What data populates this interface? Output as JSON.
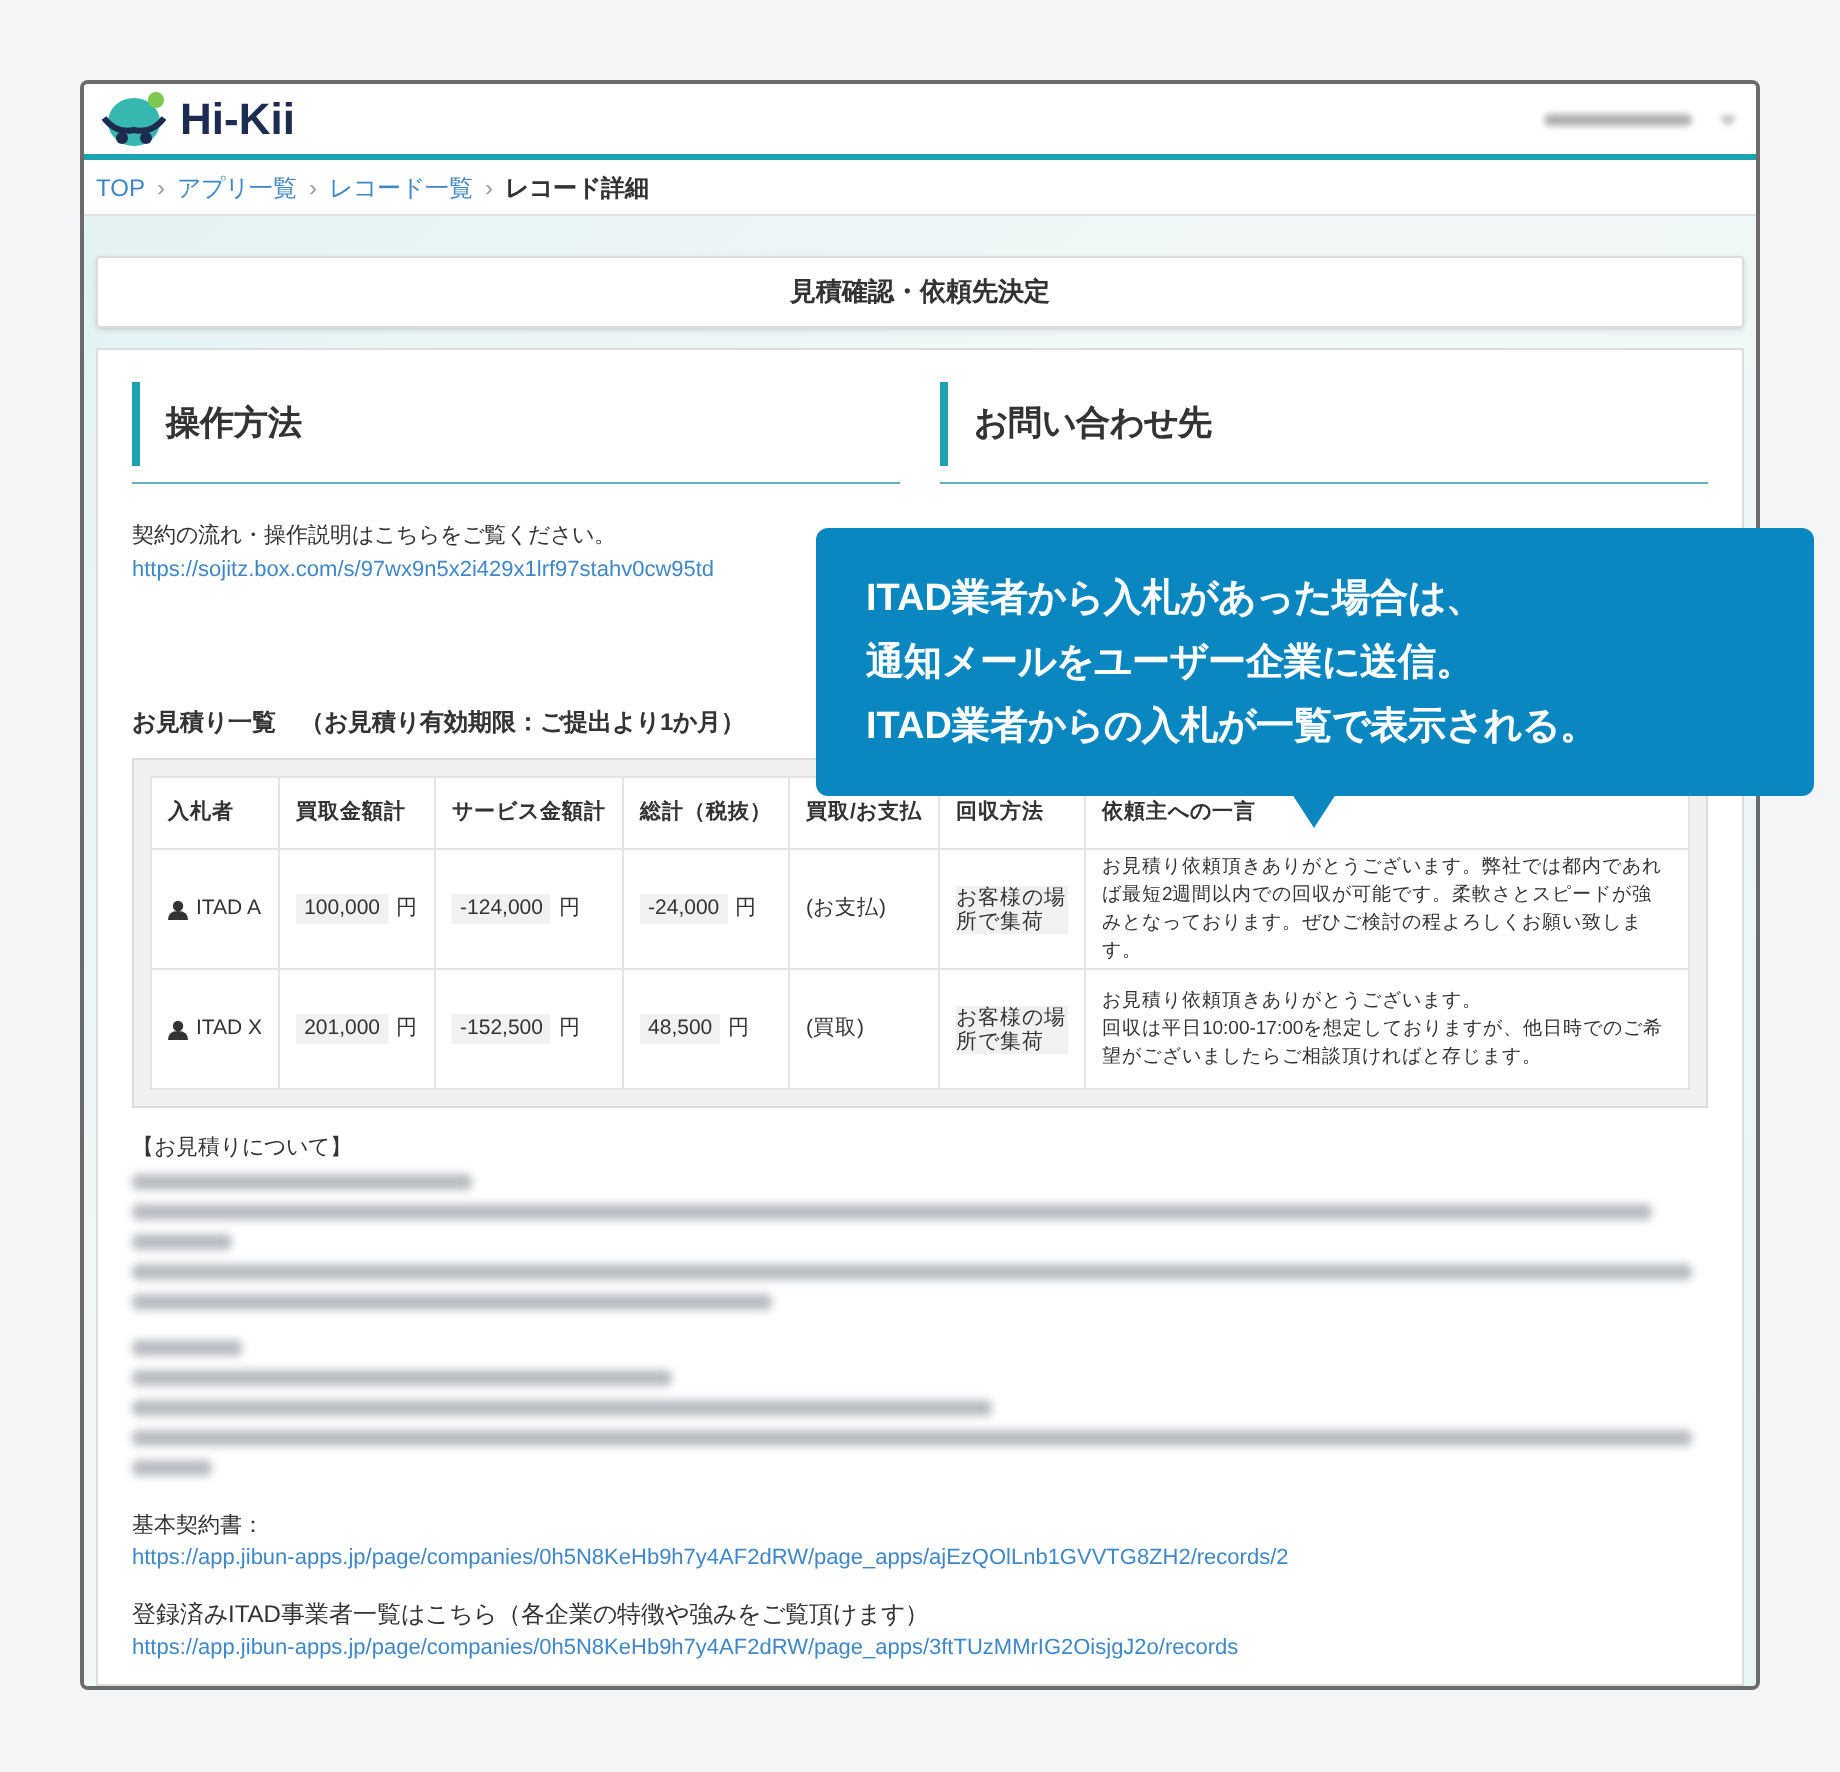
{
  "header": {
    "logo_text": "Hi-Kii"
  },
  "breadcrumb_separator": "›",
  "breadcrumb": [
    {
      "label": "TOP",
      "link": true
    },
    {
      "label": "アプリ一覧",
      "link": true
    },
    {
      "label": "レコード一覧",
      "link": true
    },
    {
      "label": "レコード詳細",
      "link": false
    }
  ],
  "page_title": "見積確認・依頼先決定",
  "sections": [
    {
      "title": "操作方法",
      "text": "契約の流れ・操作説明はこちらをご覧ください。",
      "link": "https://sojitz.box.com/s/97wx9n5x2i429x1lrf97stahv0cw95td"
    },
    {
      "title": "お問い合わせ先"
    }
  ],
  "quotes": {
    "title": "お見積り一覧　（お見積り有効期限：ご提出より1か月）",
    "columns": [
      "入札者",
      "買取金額計",
      "サービス金額計",
      "総計（税抜）",
      "買取/お支払",
      "回収方法",
      "依頼主への一言"
    ],
    "rows": [
      {
        "bidder": "ITAD A",
        "buy": {
          "value": "100,000",
          "unit": "円"
        },
        "service": {
          "value": "-124,000",
          "unit": "円"
        },
        "total": {
          "value": "-24,000",
          "unit": "円"
        },
        "payment": "(お支払)",
        "collection": "お客様の場所で集荷",
        "message": [
          "お見積り依頼頂きありがとうございます。弊社では都内であれば最短2週間以内での回収が可能です。柔軟さとスピードが強みとなっております。ぜひご検討の程よろしくお願い致します。"
        ]
      },
      {
        "bidder": "ITAD X",
        "buy": {
          "value": "201,000",
          "unit": "円"
        },
        "service": {
          "value": "-152,500",
          "unit": "円"
        },
        "total": {
          "value": "48,500",
          "unit": "円"
        },
        "payment": "(買取)",
        "collection": "お客様の場所で集荷",
        "message": [
          "お見積り依頼頂きありがとうございます。",
          "回収は平日10:00-17:00を想定しておりますが、他日時でのご希望がございましたらご相談頂ければと存じます。"
        ]
      }
    ]
  },
  "notes_heading": "【お見積りについて】",
  "links": [
    {
      "label": "基本契約書：",
      "url": "https://app.jibun-apps.jp/page/companies/0h5N8KeHb9h7y4AF2dRW/page_apps/ajEzQOlLnb1GVVTG8ZH2/records/2"
    },
    {
      "label": "登録済みITAD事業者一覧はこちら（各企業の特徴や強みをご覧頂けます）",
      "url": "https://app.jibun-apps.jp/page/companies/0h5N8KeHb9h7y4AF2dRW/page_apps/3ftTUzMMrIG2OisjgJ2o/records"
    }
  ],
  "callout": {
    "lines": [
      "ITAD業者から入札があった場合は、",
      "通知メールをユーザー企業に送信。",
      "ITAD業者からの入札が一覧で表示される。"
    ]
  }
}
